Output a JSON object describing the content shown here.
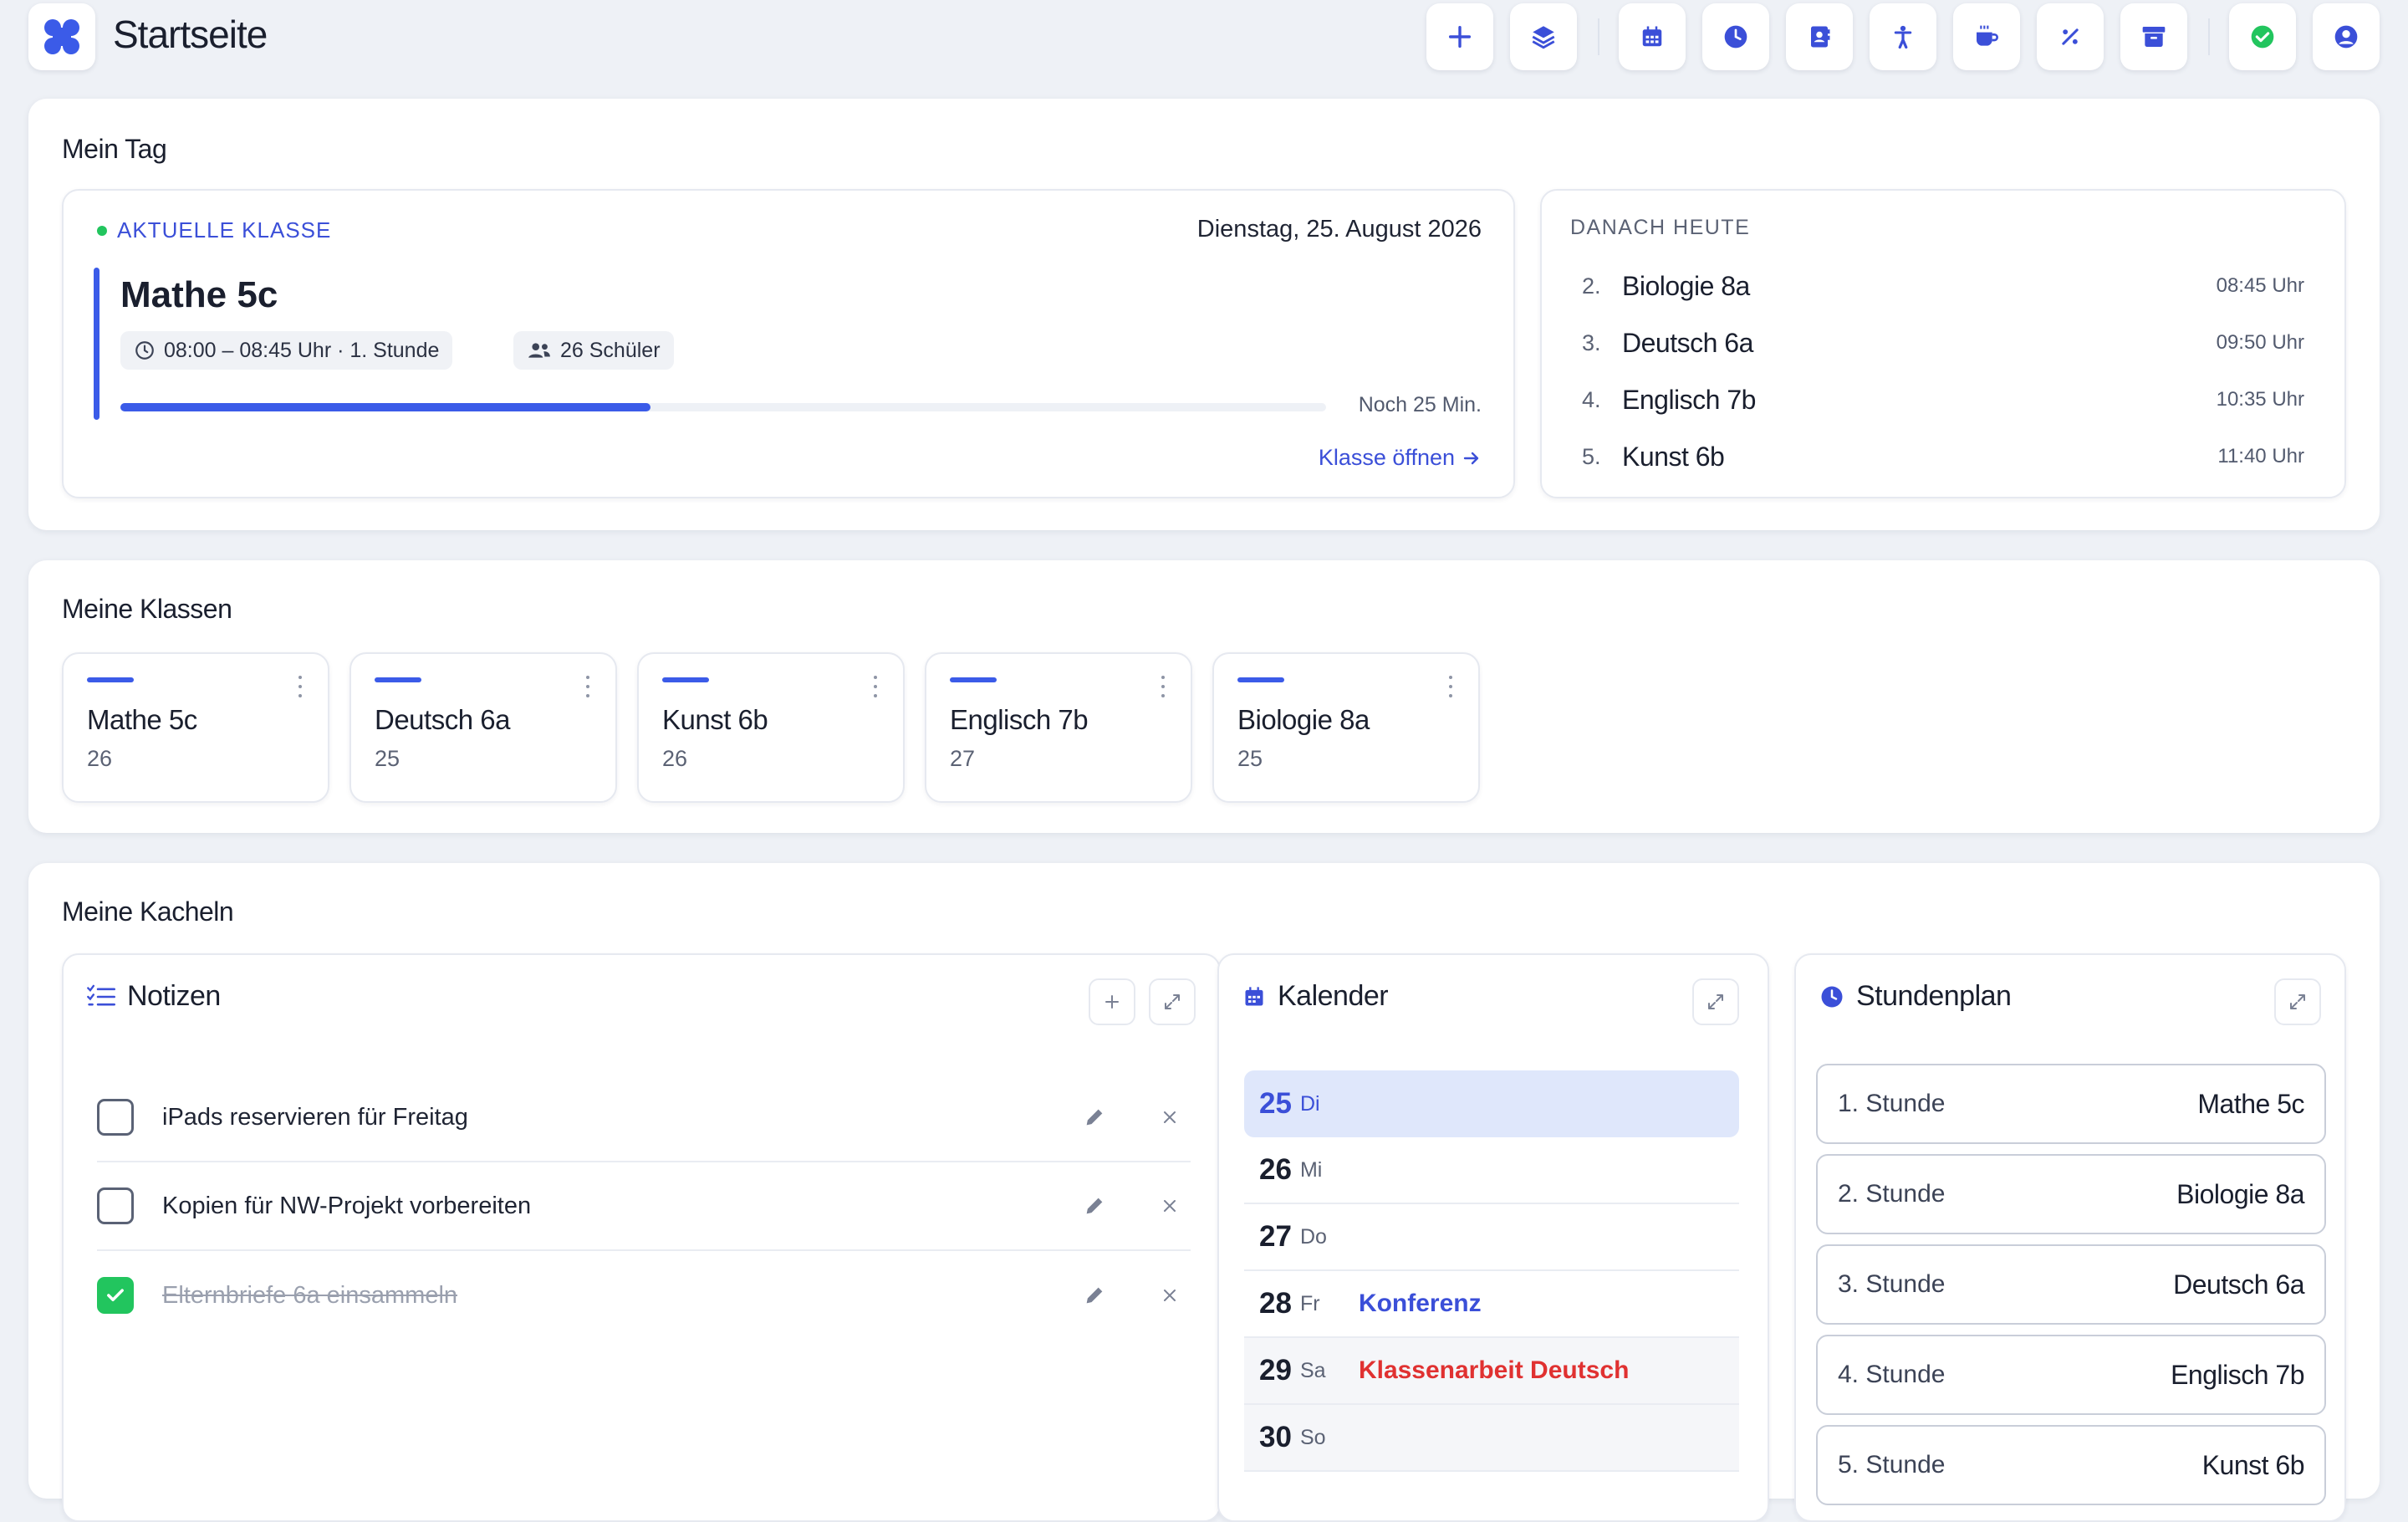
{
  "header": {
    "title": "Startseite",
    "toolbar": [
      {
        "icon": "plus-icon"
      },
      {
        "icon": "layers-icon"
      },
      {
        "icon": "calendar-icon"
      },
      {
        "icon": "clock-icon"
      },
      {
        "icon": "contact-book-icon"
      },
      {
        "icon": "person-icon"
      },
      {
        "icon": "coffee-icon"
      },
      {
        "icon": "percent-icon"
      },
      {
        "icon": "archive-icon"
      },
      {
        "icon": "status-check-icon"
      },
      {
        "icon": "user-account-icon"
      }
    ]
  },
  "my_day": {
    "title": "Mein Tag",
    "current": {
      "label": "AKTUELLE KLASSE",
      "date": "Dienstag, 25. August 2026",
      "class_name": "Mathe 5c",
      "time_chip": "08:00 – 08:45 Uhr · 1. Stunde",
      "students_chip": "26 Schüler",
      "progress": 0.44,
      "remaining": "Noch 25 Min.",
      "open_link": "Klasse öffnen"
    },
    "next": {
      "label": "DANACH HEUTE",
      "items": [
        {
          "num": "2.",
          "name": "Biologie 8a",
          "time": "08:45 Uhr"
        },
        {
          "num": "3.",
          "name": "Deutsch 6a",
          "time": "09:50 Uhr"
        },
        {
          "num": "4.",
          "name": "Englisch 7b",
          "time": "10:35 Uhr"
        },
        {
          "num": "5.",
          "name": "Kunst 6b",
          "time": "11:40 Uhr"
        }
      ]
    }
  },
  "my_classes": {
    "title": "Meine Klassen",
    "items": [
      {
        "name": "Mathe 5c",
        "count": "26"
      },
      {
        "name": "Deutsch 6a",
        "count": "25"
      },
      {
        "name": "Kunst 6b",
        "count": "26"
      },
      {
        "name": "Englisch 7b",
        "count": "27"
      },
      {
        "name": "Biologie 8a",
        "count": "25"
      }
    ]
  },
  "my_tiles": {
    "title": "Meine Kacheln",
    "notes": {
      "title": "Notizen",
      "items": [
        {
          "text": "iPads reservieren für Freitag",
          "done": false
        },
        {
          "text": "Kopien für NW-Projekt vorbereiten",
          "done": false
        },
        {
          "text": "Elternbriefe 6a einsammeln",
          "done": true
        }
      ]
    },
    "calendar": {
      "title": "Kalender",
      "days": [
        {
          "day": "25",
          "weekday": "Di",
          "event": "",
          "event_color": ""
        },
        {
          "day": "26",
          "weekday": "Mi",
          "event": "",
          "event_color": ""
        },
        {
          "day": "27",
          "weekday": "Do",
          "event": "",
          "event_color": ""
        },
        {
          "day": "28",
          "weekday": "Fr",
          "event": "Konferenz",
          "event_color": "#3b4fd8"
        },
        {
          "day": "29",
          "weekday": "Sa",
          "event": "Klassenarbeit Deutsch",
          "event_color": "#e03131"
        },
        {
          "day": "30",
          "weekday": "So",
          "event": "",
          "event_color": ""
        }
      ]
    },
    "schedule": {
      "title": "Stundenplan",
      "items": [
        {
          "slot": "1. Stunde",
          "class": "Mathe 5c"
        },
        {
          "slot": "2. Stunde",
          "class": "Biologie 8a"
        },
        {
          "slot": "3. Stunde",
          "class": "Deutsch 6a"
        },
        {
          "slot": "4. Stunde",
          "class": "Englisch 7b"
        },
        {
          "slot": "5. Stunde",
          "class": "Kunst 6b"
        }
      ]
    }
  },
  "colors": {
    "accent": "#3b4fd8",
    "success": "#22c55e",
    "danger": "#e03131",
    "background": "#eef1f6"
  }
}
